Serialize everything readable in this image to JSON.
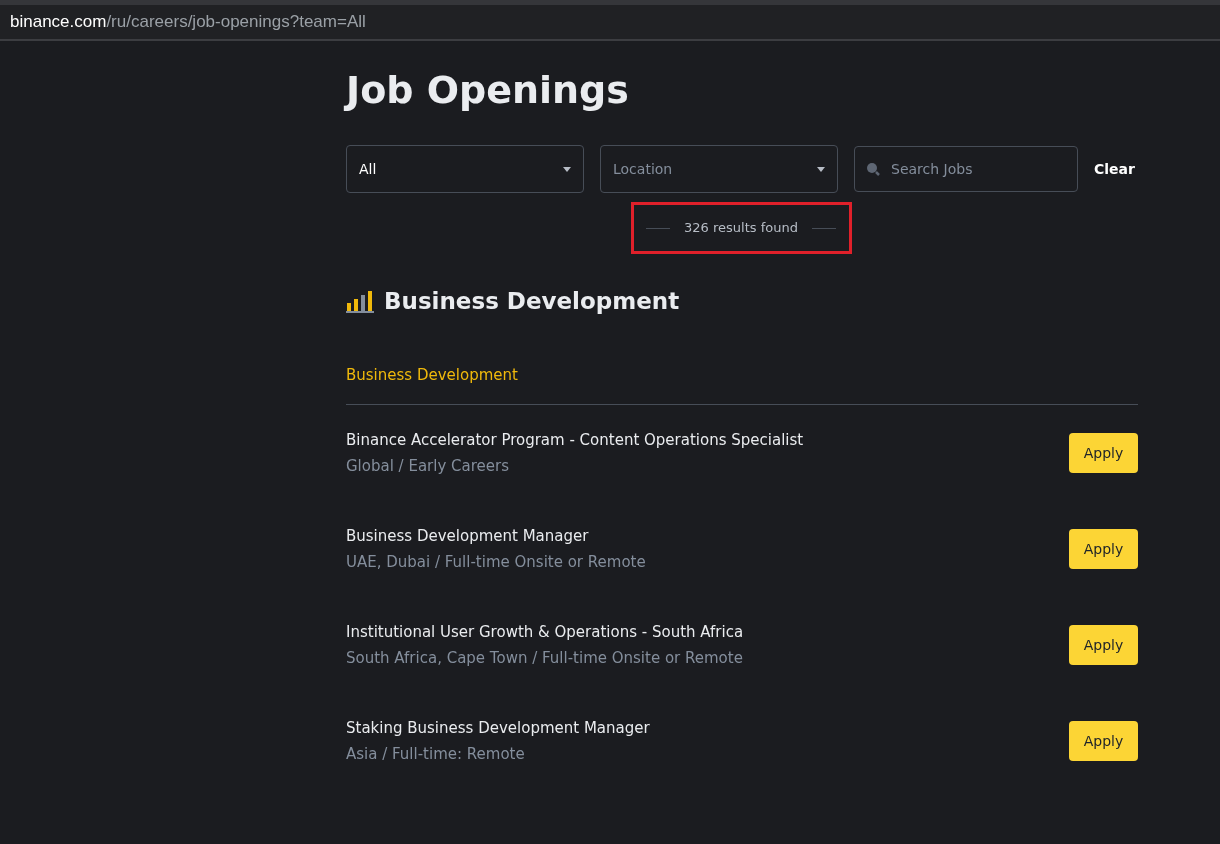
{
  "address_bar": {
    "domain": "binance.com",
    "path": "/ru/careers/job-openings?team=All"
  },
  "title": "Job Openings",
  "filters": {
    "team": {
      "value": "All"
    },
    "location": {
      "placeholder": "Location"
    },
    "search": {
      "placeholder": "Search Jobs"
    },
    "clear": "Clear"
  },
  "results": "326 results found",
  "section": {
    "heading": "Business Development",
    "subheading": "Business Development"
  },
  "jobs": [
    {
      "title": "Binance Accelerator Program - Content Operations Specialist",
      "details": "Global / Early Careers",
      "action": "Apply"
    },
    {
      "title": "Business Development Manager",
      "details": "UAE, Dubai / Full-time Onsite or Remote",
      "action": "Apply"
    },
    {
      "title": "Institutional User Growth & Operations - South Africa",
      "details": "South Africa, Cape Town / Full-time Onsite or Remote",
      "action": "Apply"
    },
    {
      "title": "Staking Business Development Manager",
      "details": "Asia / Full-time: Remote",
      "action": "Apply"
    }
  ]
}
